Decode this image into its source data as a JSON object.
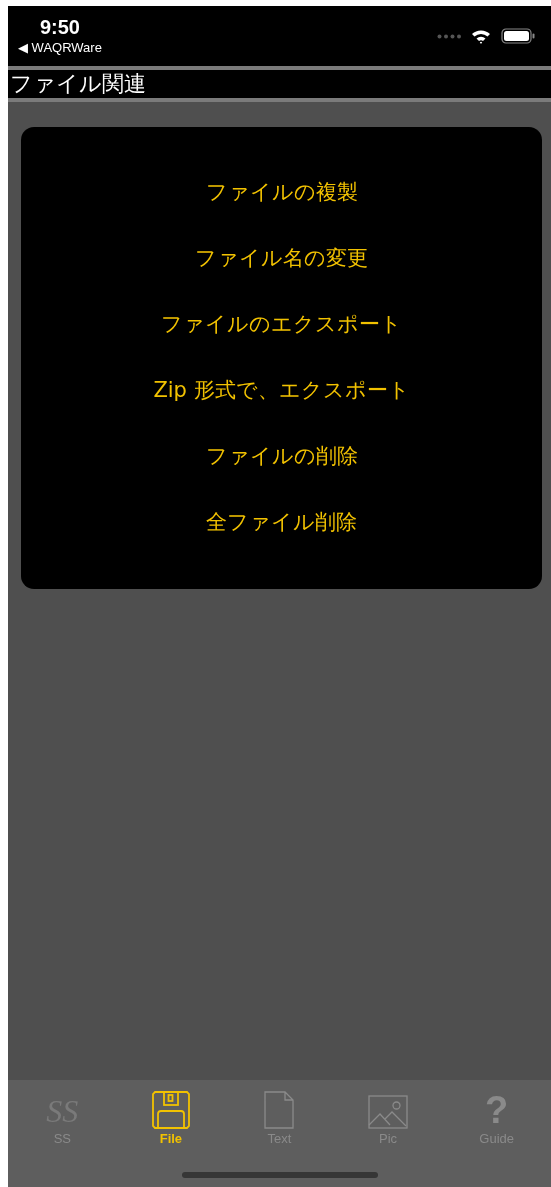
{
  "status_bar": {
    "time": "9:50",
    "back_label": "◀ WAQRWare"
  },
  "header": {
    "title": "ファイル関連"
  },
  "menu": [
    {
      "label": "ファイルの複製"
    },
    {
      "label": "ファイル名の変更"
    },
    {
      "label": "ファイルのエクスポート"
    },
    {
      "label": "Zip 形式で、エクスポート"
    },
    {
      "label": "ファイルの削除"
    },
    {
      "label": "全ファイル削除"
    }
  ],
  "tabs": [
    {
      "kind": "ss",
      "glyph": "SS",
      "label": "SS",
      "selected": false
    },
    {
      "kind": "file",
      "label": "File",
      "selected": true
    },
    {
      "kind": "text",
      "label": "Text",
      "selected": false
    },
    {
      "kind": "pic",
      "label": "Pic",
      "selected": false
    },
    {
      "kind": "guide",
      "glyph": "?",
      "label": "Guide",
      "selected": false
    }
  ]
}
